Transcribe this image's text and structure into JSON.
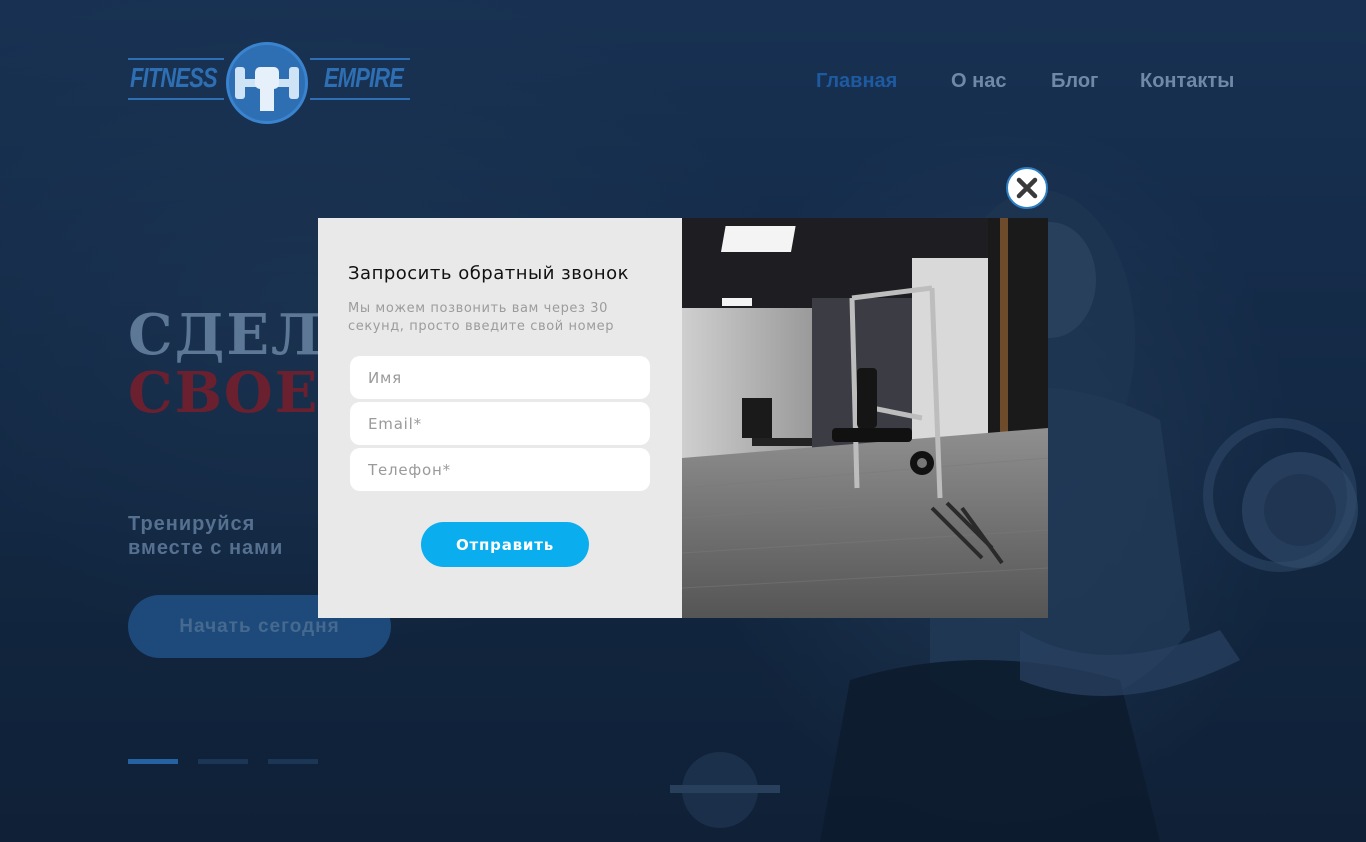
{
  "brand": {
    "logo_left": "FITNESS",
    "logo_right": "EMPIRE",
    "logo_icon": "fist-dumbbell-icon"
  },
  "nav": {
    "items": [
      {
        "label": "Главная",
        "active": true
      },
      {
        "label": "О нас",
        "active": false
      },
      {
        "label": "Блог",
        "active": false
      },
      {
        "label": "Контакты",
        "active": false
      }
    ]
  },
  "hero": {
    "line1": "СДЕЛА",
    "line2": "СВОЕЙ",
    "tagline_line1": "Тренируйся",
    "tagline_line2": "вместе с нами",
    "cta_label": "Начать сегодня",
    "slider": {
      "count": 3,
      "active_index": 0
    }
  },
  "modal": {
    "title": "Запросить обратный звонок",
    "subtitle": "Мы можем позвонить вам через 30 секунд, просто введите свой номер",
    "fields": [
      {
        "placeholder": "Имя",
        "value": ""
      },
      {
        "placeholder": "Email*",
        "value": ""
      },
      {
        "placeholder": "Телефон*",
        "value": ""
      }
    ],
    "submit_label": "Отправить",
    "close_icon": "close-icon",
    "photo": "gym-interior-photo"
  },
  "colors": {
    "background": "#1b3352",
    "accent": "#0aaeef",
    "nav_active": "#1e5aa0",
    "nav_inactive": "#7189a8",
    "hero_line2": "#6b2030",
    "modal_bg": "#e9e9e9"
  }
}
